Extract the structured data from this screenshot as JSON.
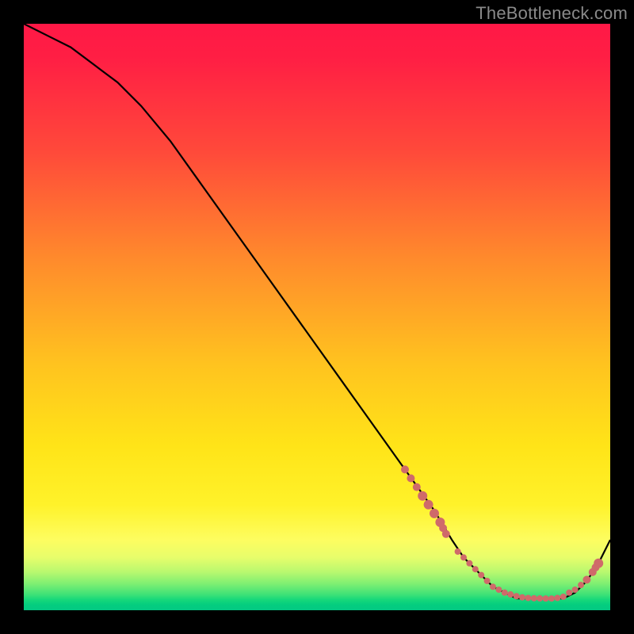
{
  "watermark": "TheBottleneck.com",
  "chart_data": {
    "type": "line",
    "title": "",
    "xlabel": "",
    "ylabel": "",
    "ylim": [
      0,
      100
    ],
    "xlim": [
      0,
      100
    ],
    "series": [
      {
        "name": "curve",
        "x": [
          0,
          4,
          8,
          12,
          16,
          20,
          25,
          30,
          35,
          40,
          45,
          50,
          55,
          60,
          65,
          70,
          73,
          75,
          78,
          80,
          82,
          84,
          86,
          88,
          90,
          92,
          94,
          96,
          98,
          100
        ],
        "values": [
          100,
          98,
          96,
          93,
          90,
          86,
          80,
          73,
          66,
          59,
          52,
          45,
          38,
          31,
          24,
          17,
          12,
          9,
          6,
          4,
          3,
          2,
          2,
          2,
          2,
          2,
          3,
          5,
          8,
          12
        ]
      }
    ],
    "markers": {
      "name": "cluster",
      "x": [
        65,
        66,
        67,
        68,
        69,
        70,
        71,
        71.5,
        72,
        74,
        75,
        76,
        77,
        78,
        79,
        80,
        81,
        82,
        83,
        84,
        85,
        86,
        87,
        88,
        89,
        90,
        91,
        92,
        93,
        94,
        95,
        96,
        97,
        97.5,
        98
      ],
      "values": [
        24,
        22.5,
        21,
        19.5,
        18,
        16.5,
        15,
        14,
        13,
        10,
        9,
        8,
        7,
        6,
        5,
        4,
        3.5,
        3,
        2.7,
        2.4,
        2.2,
        2.1,
        2.05,
        2.02,
        2.0,
        2.0,
        2.1,
        2.3,
        3.0,
        3.5,
        4.3,
        5.2,
        6.5,
        7.3,
        8.0
      ],
      "r": [
        5,
        5,
        5,
        6,
        6,
        6,
        6,
        5,
        5,
        4,
        4,
        4,
        4,
        4,
        4,
        4,
        4,
        4,
        4,
        4,
        4,
        4,
        4,
        4,
        4,
        4,
        4,
        4,
        4,
        4,
        4,
        5,
        5,
        5,
        6
      ]
    },
    "colors": {
      "curve": "#000000",
      "marker": "#cf6a6a",
      "gradient_top": "#ff1846",
      "gradient_bottom": "#03c983"
    }
  }
}
